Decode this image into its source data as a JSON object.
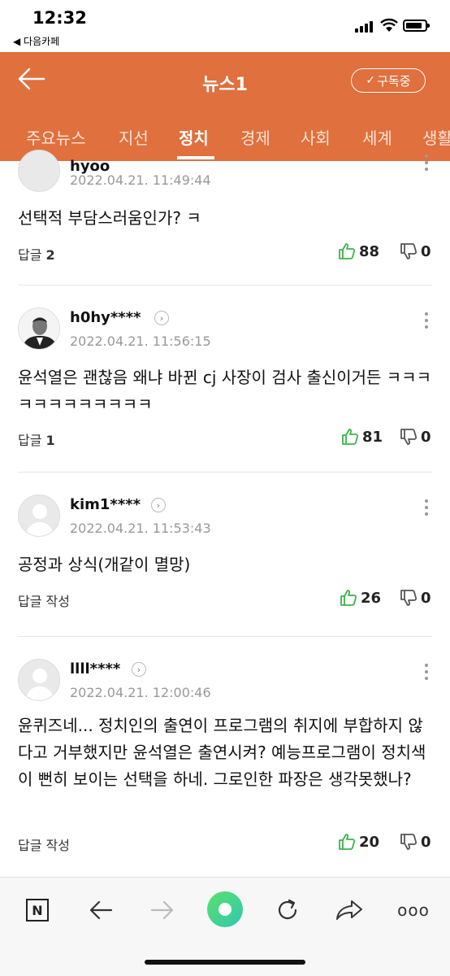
{
  "status_bar": {
    "time": "12:32",
    "back_app": "◀ 다음카페"
  },
  "header": {
    "title": "뉴스1",
    "subscribe_label": "구독중",
    "tabs": [
      "주요뉴스",
      "지선",
      "정치",
      "경제",
      "사회",
      "세계",
      "생활"
    ],
    "active_tab": "정치",
    "accent_color": "#e0703d"
  },
  "comments": [
    {
      "username": "hyoo",
      "date": "2022.04.21. 11:49:44",
      "body": "선택적 부담스러움인가? ㅋ",
      "reply_label": "답글",
      "reply_count": "2",
      "likes": "88",
      "dislikes": "0"
    },
    {
      "username": "h0hy****",
      "date": "2022.04.21. 11:56:15",
      "body": "윤석열은 괜찮음 왜냐 바뀐 cj 사장이 검사 출신이거든 ㅋㅋㅋㅋㅋㅋㅋㅋㅋㅋㅋㅋ",
      "reply_label": "답글",
      "reply_count": "1",
      "likes": "81",
      "dislikes": "0"
    },
    {
      "username": "kim1****",
      "date": "2022.04.21. 11:53:43",
      "body": "공정과 상식(개같이 멸망)",
      "reply_label": "답글 작성",
      "reply_count": "",
      "likes": "26",
      "dislikes": "0"
    },
    {
      "username": "llll****",
      "date": "2022.04.21. 12:00:46",
      "body": "윤퀴즈네... 정치인의 출연이 프로그램의 취지에 부합하지 않다고 거부했지만 윤석열은 출연시켜? 예능프로그램이 정치색이 뻔히 보이는 선택을 하네. 그로인한 파장은 생각못했나?",
      "reply_label": "답글 작성",
      "reply_count": "",
      "likes": "20",
      "dislikes": "0"
    }
  ],
  "toolbar": {
    "naver_label": "N",
    "more_label": "ooo"
  },
  "colors": {
    "like_icon": "#3bb34a",
    "green_button": "#3fd48c"
  }
}
